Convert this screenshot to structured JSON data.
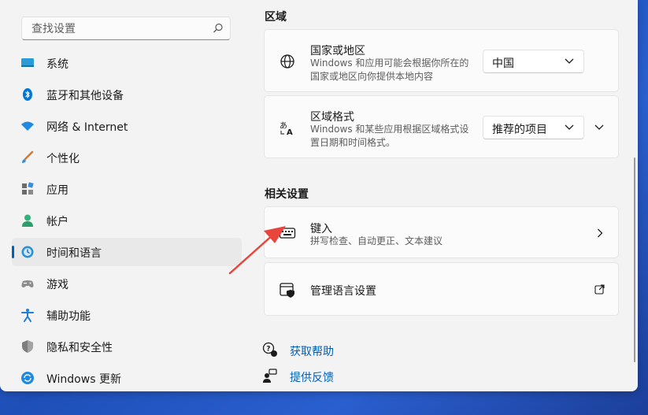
{
  "search": {
    "placeholder": "查找设置"
  },
  "sidebar": {
    "items": [
      {
        "label": "系统"
      },
      {
        "label": "蓝牙和其他设备"
      },
      {
        "label": "网络 & Internet"
      },
      {
        "label": "个性化"
      },
      {
        "label": "应用"
      },
      {
        "label": "帐户"
      },
      {
        "label": "时间和语言",
        "selected": true
      },
      {
        "label": "游戏"
      },
      {
        "label": "辅助功能"
      },
      {
        "label": "隐私和安全性"
      },
      {
        "label": "Windows 更新"
      }
    ]
  },
  "region": {
    "section_title": "区域",
    "country": {
      "title": "国家或地区",
      "description": "Windows 和应用可能会根据你所在的国家或地区向你提供本地内容",
      "value": "中国"
    },
    "format": {
      "title": "区域格式",
      "description": "Windows 和某些应用根据区域格式设置日期和时间格式。",
      "value": "推荐的项目"
    }
  },
  "related": {
    "section_title": "相关设置",
    "typing": {
      "title": "键入",
      "description": "拼写检查、自动更正、文本建议"
    },
    "language_admin": {
      "title": "管理语言设置"
    }
  },
  "help_links": {
    "get_help": "获取帮助",
    "feedback": "提供反馈"
  },
  "colors": {
    "accent": "#005fb8",
    "annotation_arrow": "#e8453c"
  }
}
